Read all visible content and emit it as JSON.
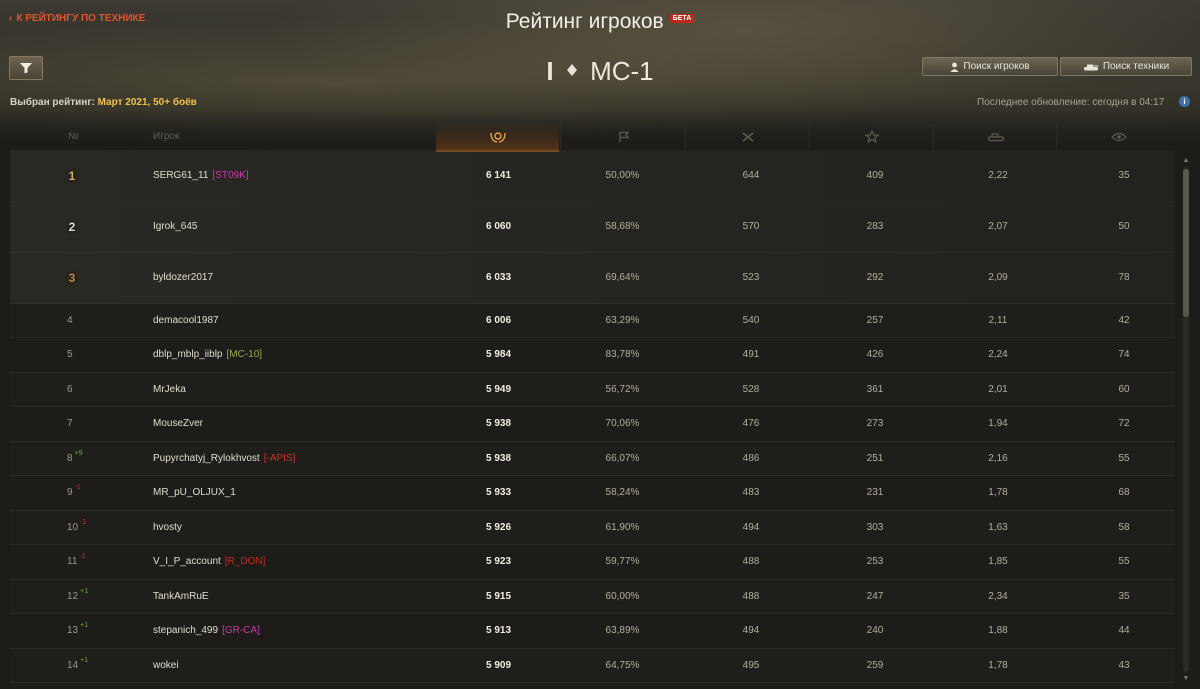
{
  "header": {
    "back_link": "К РЕЙТИНГУ ПО ТЕХНИКЕ",
    "title": "Рейтинг игроков",
    "beta_badge": "БЕТА",
    "vehicle_tier": "I",
    "vehicle_name": "MC-1",
    "search_players": "Поиск игроков",
    "search_tanks": "Поиск техники",
    "rating_label": "Выбран рейтинг: ",
    "rating_value": "Март 2021, 50+ боёв",
    "last_update": "Последнее обновление: сегодня в 04:17",
    "info": "i"
  },
  "columns": {
    "rank": "№",
    "player": "Игрок",
    "icons": [
      "laurel-icon",
      "flag-icon",
      "crossed-swords-icon",
      "star-icon",
      "tank-icon",
      "eye-icon"
    ]
  },
  "colors": {
    "accent": "#e0781e",
    "gold": "#f2c14a",
    "link_red": "#e0542e"
  },
  "rows": [
    {
      "rank": "1",
      "change": "",
      "player": "SERG61_11",
      "clan": "[ST09K]",
      "clan_color": "#c83aa8",
      "score": "6 141",
      "wins": "50,00%",
      "battles": "644",
      "exp": "409",
      "kd": "2,22",
      "spot": "35"
    },
    {
      "rank": "2",
      "change": "",
      "player": "Igrok_645",
      "clan": "",
      "clan_color": "",
      "score": "6 060",
      "wins": "58,68%",
      "battles": "570",
      "exp": "283",
      "kd": "2,07",
      "spot": "50"
    },
    {
      "rank": "3",
      "change": "",
      "player": "byldozer2017",
      "clan": "",
      "clan_color": "",
      "score": "6 033",
      "wins": "69,64%",
      "battles": "523",
      "exp": "292",
      "kd": "2,09",
      "spot": "78"
    },
    {
      "rank": "4",
      "change": "",
      "player": "demacool1987",
      "clan": "",
      "clan_color": "",
      "score": "6 006",
      "wins": "63,29%",
      "battles": "540",
      "exp": "257",
      "kd": "2,11",
      "spot": "42"
    },
    {
      "rank": "5",
      "change": "",
      "player": "dblp_mblp_iiblp",
      "clan": "[MC-10]",
      "clan_color": "#9ba84a",
      "score": "5 984",
      "wins": "83,78%",
      "battles": "491",
      "exp": "426",
      "kd": "2,24",
      "spot": "74"
    },
    {
      "rank": "6",
      "change": "",
      "player": "MrJeka",
      "clan": "",
      "clan_color": "",
      "score": "5 949",
      "wins": "56,72%",
      "battles": "528",
      "exp": "361",
      "kd": "2,01",
      "spot": "60"
    },
    {
      "rank": "7",
      "change": "",
      "player": "MouseZver",
      "clan": "",
      "clan_color": "",
      "score": "5 938",
      "wins": "70,06%",
      "battles": "476",
      "exp": "273",
      "kd": "1,94",
      "spot": "72"
    },
    {
      "rank": "8",
      "change": "+9",
      "player": "Pupyrchatyj_Rylokhvost",
      "clan": "[-APIS]",
      "clan_color": "#d0322a",
      "score": "5 938",
      "wins": "66,07%",
      "battles": "486",
      "exp": "251",
      "kd": "2,16",
      "spot": "55"
    },
    {
      "rank": "9",
      "change": "-1",
      "player": "MR_pU_OLJUX_1",
      "clan": "",
      "clan_color": "",
      "score": "5 933",
      "wins": "58,24%",
      "battles": "483",
      "exp": "231",
      "kd": "1,78",
      "spot": "68"
    },
    {
      "rank": "10",
      "change": "-1",
      "player": "hvosty",
      "clan": "",
      "clan_color": "",
      "score": "5 926",
      "wins": "61,90%",
      "battles": "494",
      "exp": "303",
      "kd": "1,63",
      "spot": "58"
    },
    {
      "rank": "11",
      "change": "-1",
      "player": "V_I_P_account",
      "clan": "[R_DON]",
      "clan_color": "#c8281e",
      "score": "5 923",
      "wins": "59,77%",
      "battles": "488",
      "exp": "253",
      "kd": "1,85",
      "spot": "55"
    },
    {
      "rank": "12",
      "change": "+1",
      "player": "TankAmRuE",
      "clan": "",
      "clan_color": "",
      "score": "5 915",
      "wins": "60,00%",
      "battles": "488",
      "exp": "247",
      "kd": "2,34",
      "spot": "35"
    },
    {
      "rank": "13",
      "change": "+1",
      "player": "stepanich_499",
      "clan": "[GR-CA]",
      "clan_color": "#c83aa8",
      "score": "5 913",
      "wins": "63,89%",
      "battles": "494",
      "exp": "240",
      "kd": "1,88",
      "spot": "44"
    },
    {
      "rank": "14",
      "change": "+1",
      "player": "wokei",
      "clan": "",
      "clan_color": "",
      "score": "5 909",
      "wins": "64,75%",
      "battles": "495",
      "exp": "259",
      "kd": "1,78",
      "spot": "43"
    }
  ]
}
